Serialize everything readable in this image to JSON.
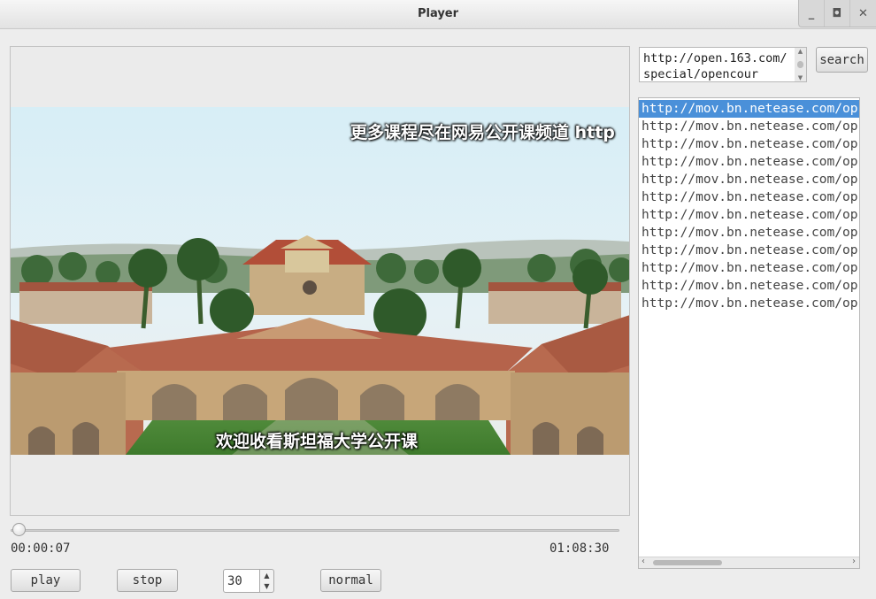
{
  "window": {
    "title": "Player",
    "buttons": {
      "minimize": "_",
      "maximize": "◘",
      "close": "✕"
    }
  },
  "video": {
    "subtitle_top": "更多课程尽在网易公开课频道 http",
    "subtitle_bottom": "欢迎收看斯坦福大学公开课"
  },
  "playback": {
    "progress": 0.002,
    "current_time": "00:00:07",
    "total_time": "01:08:30"
  },
  "controls": {
    "play_label": "play",
    "stop_label": "stop",
    "speed_value": "30",
    "normal_label": "normal"
  },
  "search": {
    "url_value": "http://open.163.com/special/opencour",
    "button_label": "search"
  },
  "results": {
    "selected_index": 0,
    "items": [
      "http://mov.bn.netease.com/op",
      "http://mov.bn.netease.com/op",
      "http://mov.bn.netease.com/op",
      "http://mov.bn.netease.com/op",
      "http://mov.bn.netease.com/op",
      "http://mov.bn.netease.com/op",
      "http://mov.bn.netease.com/op",
      "http://mov.bn.netease.com/op",
      "http://mov.bn.netease.com/op",
      "http://mov.bn.netease.com/op",
      "http://mov.bn.netease.com/op",
      "http://mov.bn.netease.com/op"
    ]
  },
  "icons": {
    "spin_up": "chevron-up-icon",
    "spin_down": "chevron-down-icon",
    "scroll_left": "chevron-left-icon",
    "scroll_right": "chevron-right-icon"
  }
}
